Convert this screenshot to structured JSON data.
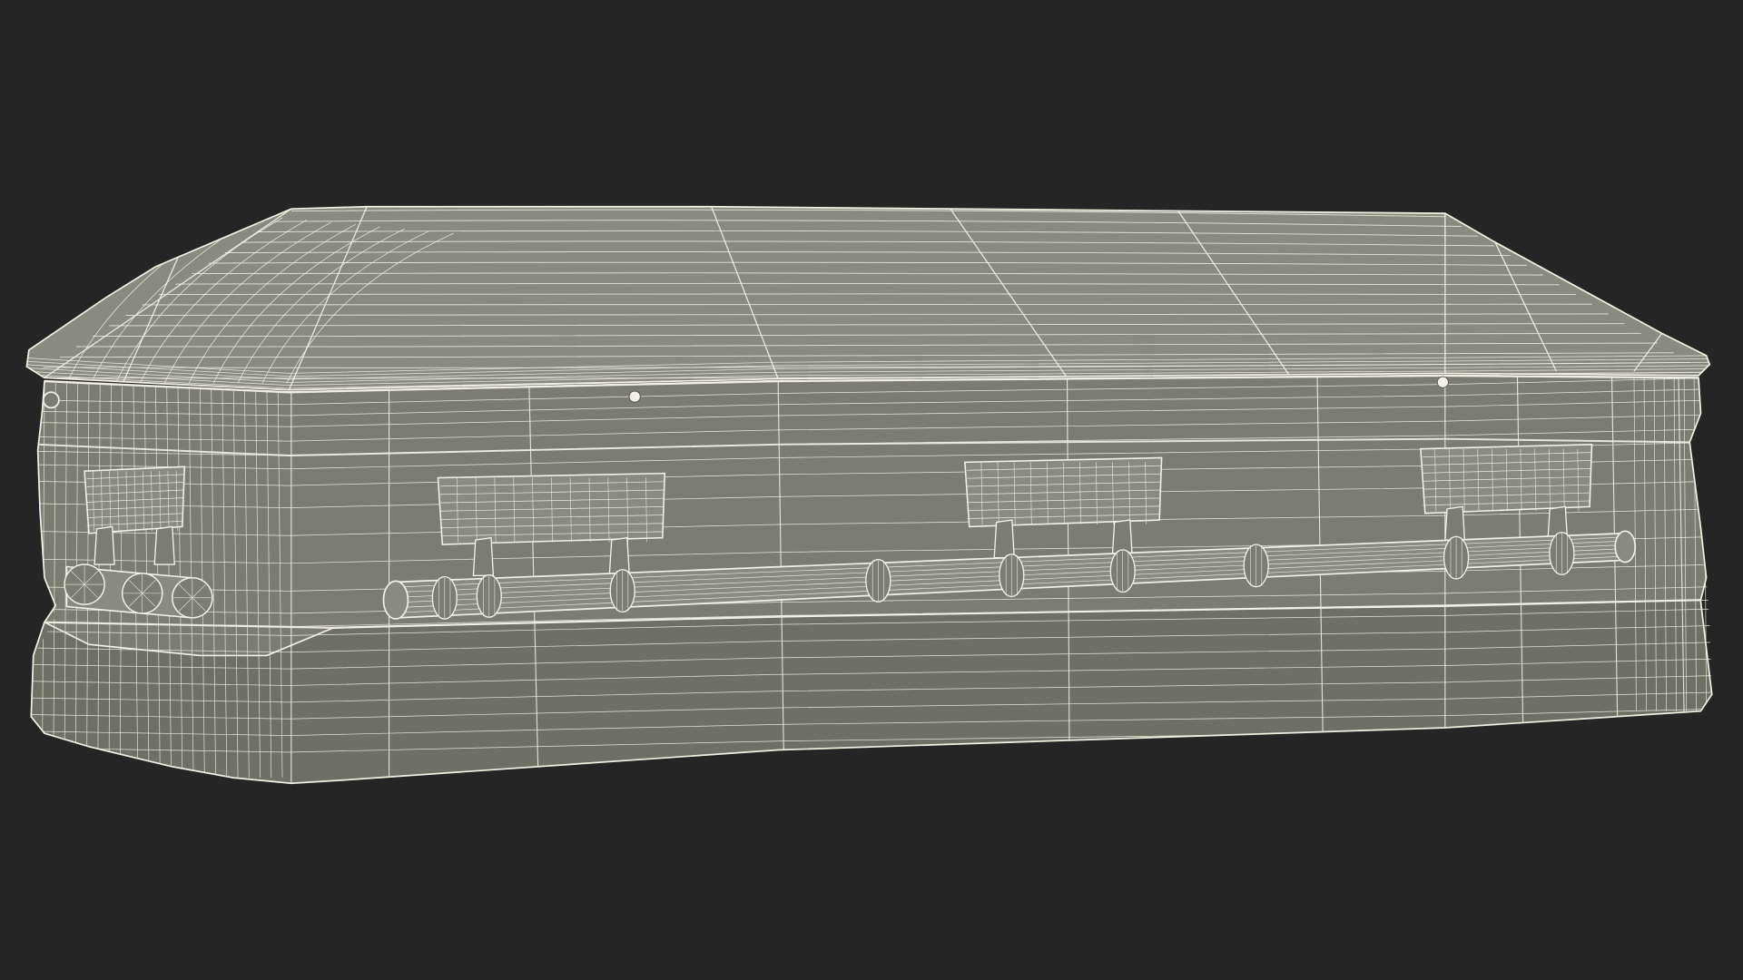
{
  "scene": {
    "subject_icon": "casket-wireframe-icon",
    "colors": {
      "background": "#252525",
      "surface": "#7c7d72",
      "surface_dark": "#6e6f65",
      "surface_light": "#8a8b80",
      "wire": "#f2f1e3"
    },
    "handle_count": 4,
    "lid_buttons": 2
  }
}
